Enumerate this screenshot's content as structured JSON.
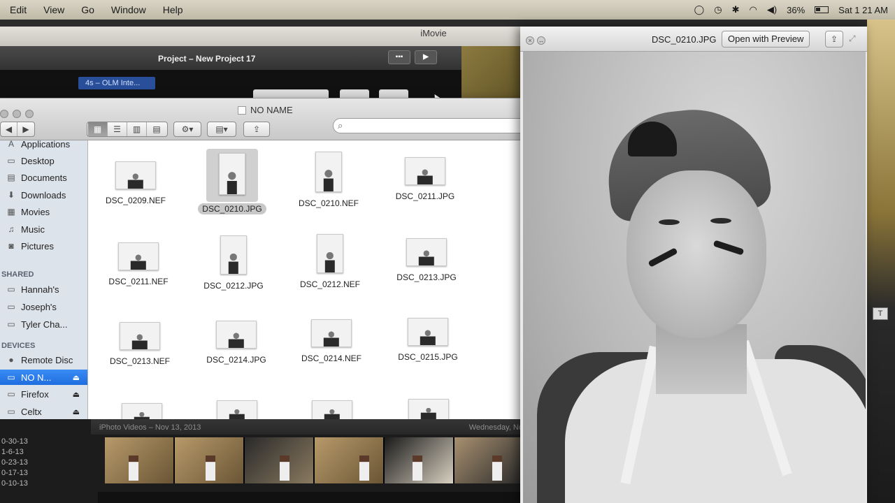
{
  "menubar": {
    "items": [
      "Edit",
      "View",
      "Go",
      "Window",
      "Help"
    ],
    "battery": "36%",
    "clock": "Sat 1 21 AM"
  },
  "imovie": {
    "title": "iMovie",
    "project_title": "Project – New Project 17",
    "clip_label": "4s – OLM Inte..."
  },
  "finder": {
    "title": "NO NAME",
    "search_placeholder": "",
    "sidebar": {
      "favorites": [
        "Applications",
        "Desktop",
        "Documents",
        "Downloads",
        "Movies",
        "Music",
        "Pictures"
      ],
      "shared_heading": "SHARED",
      "shared": [
        "Hannah's",
        "Joseph's",
        "Tyler Cha..."
      ],
      "devices_heading": "DEVICES",
      "devices": [
        "Remote Disc",
        "NO N...",
        "Firefox",
        "Celtx"
      ]
    },
    "files": [
      "DSC_0209.NEF",
      "DSC_0210.JPG",
      "DSC_0210.NEF",
      "DSC_0211.JPG",
      "DSC_0211.NEF",
      "DSC_0212.JPG",
      "DSC_0212.NEF",
      "DSC_0213.JPG",
      "DSC_0213.NEF",
      "DSC_0214.JPG",
      "DSC_0214.NEF",
      "DSC_0215.JPG"
    ],
    "selected_file": "DSC_0210.JPG"
  },
  "events": {
    "header_left": "iPhoto Videos – Nov 13, 2013",
    "header_right": "Wednesday, No",
    "dates": [
      "0-30-13",
      "1-6-13",
      "0-23-13",
      "0-17-13",
      "0-10-13"
    ]
  },
  "quicklook": {
    "filename": "DSC_0210.JPG",
    "open_button": "Open with Preview"
  },
  "icons": {
    "share": "share-icon",
    "search": "search-icon",
    "gear": "gear-icon"
  }
}
